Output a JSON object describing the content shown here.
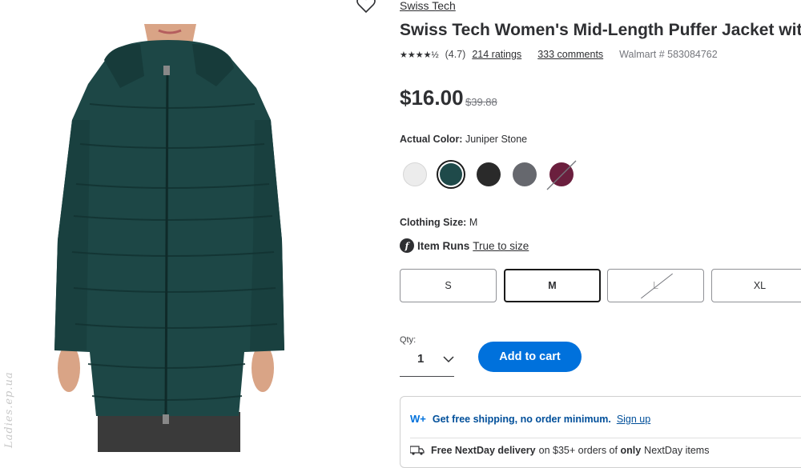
{
  "product": {
    "brand": "Swiss Tech",
    "title": "Swiss Tech Women's Mid-Length Puffer Jacket with H",
    "stars": "★★★★½",
    "rating_value": "(4.7)",
    "rating_fraction": 0.94,
    "ratings_link": "214 ratings",
    "comments_link": "333 comments",
    "walmart_number": "Walmart # 583084762",
    "price": "$16.00",
    "was_price": "$39.88"
  },
  "color": {
    "label": "Actual Color:",
    "value": "Juniper Stone",
    "swatches": [
      {
        "name": "white",
        "hex": "#ececec"
      },
      {
        "name": "juniper-stone",
        "hex": "#1f4a4a",
        "selected": true
      },
      {
        "name": "black",
        "hex": "#2a2a2a"
      },
      {
        "name": "grey",
        "hex": "#66686e"
      },
      {
        "name": "burgundy",
        "hex": "#6b1f3e",
        "unavailable": true
      }
    ]
  },
  "size": {
    "label": "Clothing Size:",
    "value": "M",
    "fit_label": "Item Runs",
    "fit_link": "True to size",
    "options": [
      "S",
      "M",
      "L",
      "XL"
    ]
  },
  "quantity": {
    "label": "Qty:",
    "value": "1"
  },
  "cart": {
    "add_label": "Add to cart"
  },
  "shipping": {
    "wplus": "W+",
    "free_shipping": "Get free shipping, no order minimum.",
    "signup": "Sign up",
    "nextday_bold": "Free NextDay delivery",
    "nextday_mid": "on $35+ orders of",
    "nextday_only": "only",
    "nextday_rest": "NextDay items"
  },
  "image": {
    "watermark": "Ladies.ep.ua"
  },
  "colors": {
    "accent": "#0071dc",
    "jacket": "#1d4746",
    "text": "#2e2f32"
  }
}
